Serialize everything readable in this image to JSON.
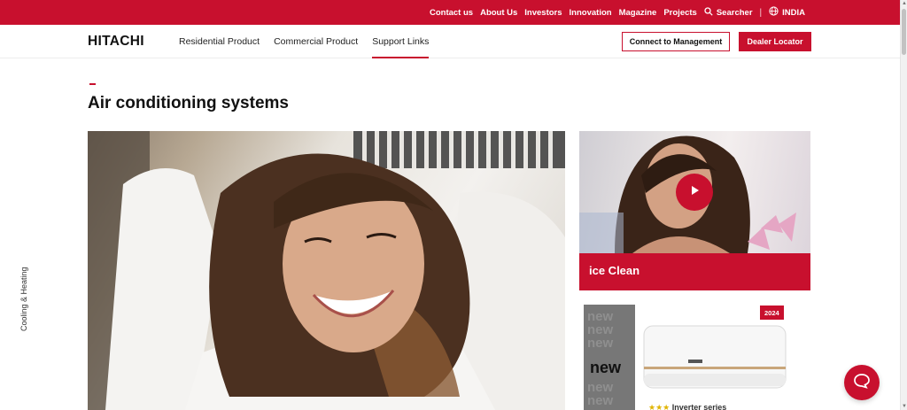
{
  "topbar": {
    "links": [
      "Contact us",
      "About Us",
      "Investors",
      "Innovation",
      "Magazine",
      "Projects"
    ],
    "search_label": "Searcher",
    "region_label": "INDIA"
  },
  "header": {
    "logo": "HITACHI",
    "nav": [
      "Residential Product",
      "Commercial Product",
      "Support Links"
    ],
    "active_nav": "Support Links",
    "connect_button": "Connect to Management",
    "dealer_button": "Dealer Locator"
  },
  "main": {
    "page_title": "Air conditioning systems",
    "side_label": "Cooling & Heating",
    "video_card": {
      "caption": "ice Clean"
    },
    "product_card": {
      "new_label": "new",
      "year_badge": "2024",
      "caption": "Inverter series"
    }
  },
  "colors": {
    "accent": "#c8102e"
  },
  "icons": [
    "search-icon",
    "globe-icon",
    "play-icon",
    "chat-icon"
  ]
}
